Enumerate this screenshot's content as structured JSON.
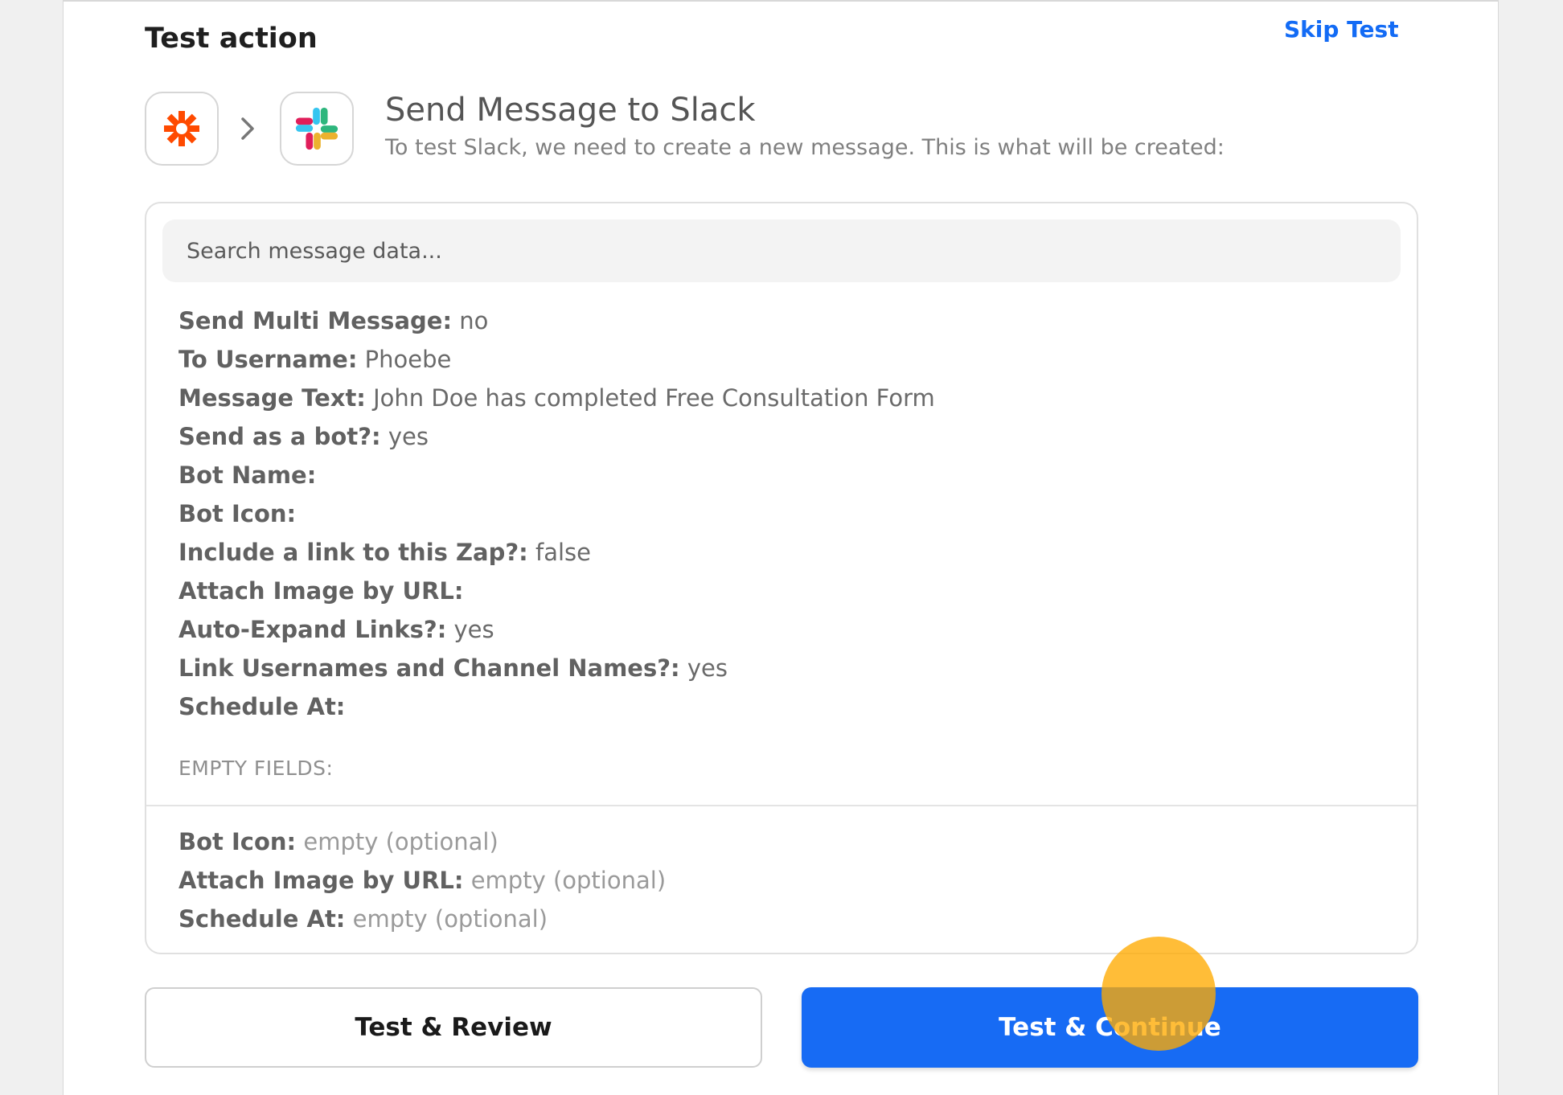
{
  "header": {
    "title": "Test action",
    "skip_label": "Skip Test"
  },
  "step": {
    "title": "Send Message to Slack",
    "subtitle": "To test Slack, we need to create a new message. This is what will be created:"
  },
  "colors": {
    "accent": "#176bf4",
    "link": "#136bf5",
    "zapier_orange": "#ff4a00",
    "cursor_highlight": "#ffaa00"
  },
  "search": {
    "placeholder": "Search message data..."
  },
  "fields": [
    {
      "key": "Send Multi Message:",
      "value": "no"
    },
    {
      "key": "To Username:",
      "value": "Phoebe"
    },
    {
      "key": "Message Text:",
      "value": "John Doe has completed Free Consultation Form"
    },
    {
      "key": "Send as a bot?:",
      "value": "yes"
    },
    {
      "key": "Bot Name:",
      "value": ""
    },
    {
      "key": "Bot Icon:",
      "value": ""
    },
    {
      "key": "Include a link to this Zap?:",
      "value": "false"
    },
    {
      "key": "Attach Image by URL:",
      "value": ""
    },
    {
      "key": "Auto-Expand Links?:",
      "value": "yes"
    },
    {
      "key": "Link Usernames and Channel Names?:",
      "value": "yes"
    },
    {
      "key": "Schedule At:",
      "value": ""
    }
  ],
  "empty_section": {
    "heading": "EMPTY FIELDS:",
    "items": [
      {
        "key": "Bot Icon:",
        "value": "empty (optional)"
      },
      {
        "key": "Attach Image by URL:",
        "value": "empty (optional)"
      },
      {
        "key": "Schedule At:",
        "value": "empty (optional)"
      }
    ]
  },
  "buttons": {
    "review": "Test & Review",
    "continue": "Test & Continue"
  },
  "icons": {
    "trigger": "zapier-asterisk-icon",
    "arrow": "chevron-right-icon",
    "action": "slack-icon"
  }
}
